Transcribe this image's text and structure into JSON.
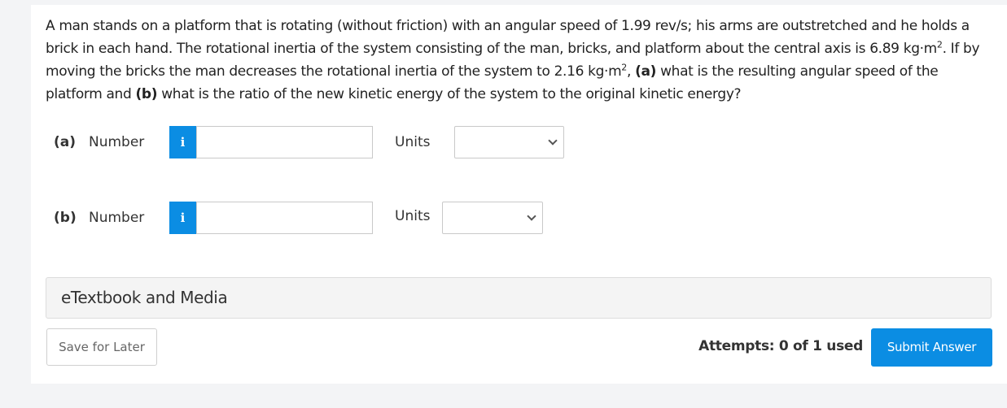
{
  "question": {
    "text_1": "A man stands on a platform that is rotating (without friction) with an angular speed of 1.99 rev/s; his arms are outstretched and he holds a brick in each hand. The rotational inertia of the system consisting of the man, bricks, and platform about the central axis is 6.89 kg·m",
    "sup_1": "2",
    "text_2": ". If by moving the bricks the man decreases the rotational inertia of the system to 2.16 kg·m",
    "sup_2": "2",
    "text_3": ", ",
    "bold_a": "(a)",
    "text_4": " what is the resulting angular speed of the platform and ",
    "bold_b": "(b)",
    "text_5": " what is the ratio of the new kinetic energy of the system to the original kinetic energy?"
  },
  "parts": [
    {
      "label": "(a)",
      "number_label": "Number",
      "info_icon": "i",
      "value": "",
      "units_label": "Units",
      "units_value": ""
    },
    {
      "label": "(b)",
      "number_label": "Number",
      "info_icon": "i",
      "value": "",
      "units_label": "Units",
      "units_value": ""
    }
  ],
  "etextbook": {
    "label": "eTextbook and Media"
  },
  "footer": {
    "save_label": "Save for Later",
    "attempts_label": "Attempts: 0 of 1 used",
    "submit_label": "Submit Answer"
  },
  "colors": {
    "accent": "#0b8de3",
    "panel": "#f4f4f4",
    "background": "#f3f4f6"
  }
}
